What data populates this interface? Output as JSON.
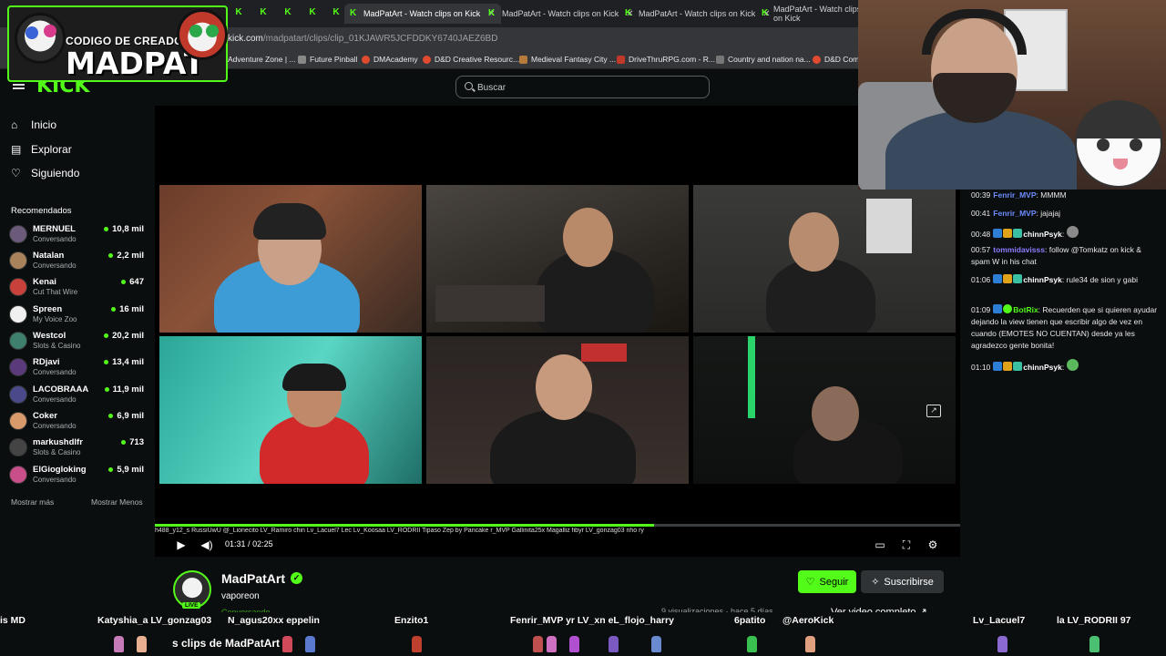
{
  "browser": {
    "tabs": [
      {
        "label": "MadPatArt - Watch clips on Kick",
        "active": true
      },
      {
        "label": "MadPatArt - Watch clips on Kick",
        "active": false
      },
      {
        "label": "MadPatArt - Watch clips on Kick",
        "active": false
      },
      {
        "label": "MadPatArt - Watch clips on Kick",
        "active": false
      }
    ],
    "url_prefix": "kick.com",
    "url_path": "/madpatart/clips/clip_01KJAWR5JCFDDKY6740JAEZ6BD",
    "bookmarks": [
      "Adventure Zone | ...",
      "Future Pinball",
      "DMAcademy",
      "D&D Creative Resourc...",
      "Medieval Fantasy City ...",
      "DriveThruRPG.com - R...",
      "Country and nation na...",
      "D&D Comp"
    ]
  },
  "overlay": {
    "line1": "CODIGO DE CREADOR",
    "line2": "MADPAT"
  },
  "header": {
    "logo": "KICK",
    "search_placeholder": "Buscar"
  },
  "sidebar": {
    "nav": [
      {
        "label": "Inicio",
        "icon": "home-icon"
      },
      {
        "label": "Explorar",
        "icon": "compass-icon"
      },
      {
        "label": "Siguiendo",
        "icon": "heart-icon"
      }
    ],
    "section_title": "Recomendados",
    "streamers": [
      {
        "name": "MERNUEL",
        "category": "Conversando",
        "viewers": "10,8 mil"
      },
      {
        "name": "Natalan",
        "category": "Conversando",
        "viewers": "2,2 mil"
      },
      {
        "name": "Kenai",
        "category": "Cut That Wire",
        "viewers": "647"
      },
      {
        "name": "Spreen",
        "category": "My Voice Zoo",
        "viewers": "16 mil"
      },
      {
        "name": "Westcol",
        "category": "Slots & Casino",
        "viewers": "20,2 mil"
      },
      {
        "name": "RDjavi",
        "category": "Conversando",
        "viewers": "13,4 mil"
      },
      {
        "name": "LACOBRAAA",
        "category": "Conversando",
        "viewers": "11,9 mil"
      },
      {
        "name": "Coker",
        "category": "Conversando",
        "viewers": "6,9 mil"
      },
      {
        "name": "markushdlfr",
        "category": "Slots & Casino",
        "viewers": "713"
      },
      {
        "name": "ElGiogloking",
        "category": "Conversando",
        "viewers": "5,9 mil"
      }
    ],
    "show_more": "Mostrar más",
    "show_less": "Mostrar Menos"
  },
  "player": {
    "time_current": "01:31",
    "time_sep": "/",
    "time_total": "02:25",
    "progress": 0.62,
    "names_strip": "h488_y12_s   RussiUwU  @_Lionecito                LV_Ramiro         chin Lv_Lacuel7                       Lec Lv_Koosaa LV_RODRII          Tipaso          Zep by Pancake r_MVP         Gallinita25x   Magalliz   fibyr        LV_gonzag03  nho  ry"
  },
  "chat": {
    "messages": [
      {
        "time": "00:39",
        "user": "Fenrir_MVP",
        "text": ": MMMM",
        "color": "#6b8cff",
        "badges": []
      },
      {
        "time": "00:41",
        "user": "Fenrir_MVP",
        "text": ": jajajaj",
        "color": "#6b8cff",
        "badges": []
      },
      {
        "time": "00:48",
        "user": "chinnPsyk",
        "text": ":",
        "color": "#ffffff",
        "badges": [
          "#2d7fd6",
          "#e0a21b",
          "#3bbfa2"
        ]
      },
      {
        "time": "00:57",
        "user": "tommidavisss",
        "text": ": follow @Tomkatz on kick & spam W in his chat",
        "color": "#8a7dff",
        "badges": []
      },
      {
        "time": "01:06",
        "user": "chinnPsyk",
        "text": ": rule34 de sion y gabi",
        "color": "#ffffff",
        "badges": [
          "#2d7fd6",
          "#e0a21b",
          "#3bbfa2"
        ]
      },
      {
        "time": "01:09",
        "user": "BotRix",
        "text": ": Recuerden que si quieren ayudar dejando la view tienen que escribir algo de vez en cuando (EMOTES NO CUENTAN) desde ya les agradezco gente bonita!",
        "color": "#53fc18",
        "badges": [
          "#2d7fd6",
          "#53fc18"
        ]
      },
      {
        "time": "01:10",
        "user": "chinnPsyk",
        "text": ":",
        "color": "#ffffff",
        "badges": [
          "#2d7fd6",
          "#e0a21b",
          "#3bbfa2"
        ]
      }
    ]
  },
  "channel": {
    "name": "MadPatArt",
    "live_label": "LIVE",
    "subtitle": "vaporeon",
    "status": "Conversando",
    "follow_label": "Seguir",
    "subscribe_label": "Suscribirse",
    "meta": "9 visualizaciones · hace 5 días",
    "full_video": "Ver video completo"
  },
  "bottom_overlay": {
    "names": [
      "is MD",
      "Katyshia_a LV_gonzag03",
      "N_agus20xx eppelin",
      "Enzito1",
      "Fenrir_MVP yr LV_xn eL_flojo_harry",
      "6patito",
      "@AeroKick",
      "Lv_Lacuel7",
      "la LV_RODRII 97"
    ],
    "clip_title": "s clips de MadPatArt"
  },
  "colors": {
    "brand": "#53fc18",
    "background": "#0b0e0f"
  }
}
